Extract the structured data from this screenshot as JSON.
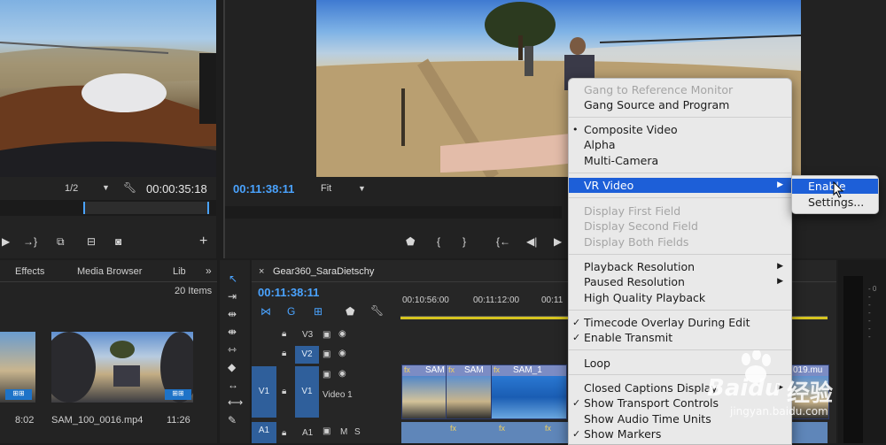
{
  "source_monitor": {
    "resolution": "1/2",
    "timecode": "00:00:35:18"
  },
  "program_monitor": {
    "timecode": "00:11:38:11",
    "fit": "Fit"
  },
  "project_panel": {
    "tabs": [
      "Effects",
      "Media Browser",
      "Lib"
    ],
    "item_count": "20 Items",
    "items": [
      {
        "name": "",
        "duration": "8:02"
      },
      {
        "name": "SAM_100_0016.mp4",
        "duration": "11:26"
      }
    ]
  },
  "timeline": {
    "sequence_name": "Gear360_SaraDietschy",
    "timecode": "00:11:38:11",
    "ruler": [
      "00:10:56:00",
      "00:11:12:00",
      "00:11"
    ],
    "tracks": [
      {
        "id": "V3",
        "name": ""
      },
      {
        "id": "V2",
        "name": ""
      },
      {
        "id": "V1",
        "source": "V1",
        "name": "Video 1"
      },
      {
        "id": "A1",
        "source": "A1",
        "m": "M",
        "s": "S"
      }
    ],
    "clips": [
      "SAM",
      "SAM",
      "SAM_1",
      "019.mu"
    ]
  },
  "context_menu": {
    "items": [
      {
        "label": "Gang to Reference Monitor",
        "disabled": true
      },
      {
        "label": "Gang Source and Program"
      },
      {
        "label": "Composite Video",
        "mark": "•"
      },
      {
        "label": "Alpha"
      },
      {
        "label": "Multi-Camera"
      },
      {
        "label": "VR Video",
        "submenu": true,
        "highlight": true
      },
      {
        "label": "Display First Field",
        "disabled": true
      },
      {
        "label": "Display Second Field",
        "disabled": true
      },
      {
        "label": "Display Both Fields",
        "disabled": true
      },
      {
        "label": "Playback Resolution",
        "submenu": true
      },
      {
        "label": "Paused Resolution",
        "submenu": true
      },
      {
        "label": "High Quality Playback"
      },
      {
        "label": "Timecode Overlay During Edit",
        "mark": "✓"
      },
      {
        "label": "Enable Transmit",
        "mark": "✓"
      },
      {
        "label": "Loop"
      },
      {
        "label": "Closed Captions Display",
        "submenu": true
      },
      {
        "label": "Show Transport Controls",
        "mark": "✓"
      },
      {
        "label": "Show Audio Time Units"
      },
      {
        "label": "Show Markers",
        "mark": "✓"
      }
    ],
    "submenu": [
      "Enable",
      "Settings..."
    ]
  },
  "watermark": {
    "brand": "Baidu",
    "brand_cn": "经验",
    "url": "jingyan.baidu.com"
  },
  "colors": {
    "accent_blue": "#4aa3ff",
    "menu_highlight": "#1d5fd8",
    "track_blue": "#2f5f9b"
  }
}
